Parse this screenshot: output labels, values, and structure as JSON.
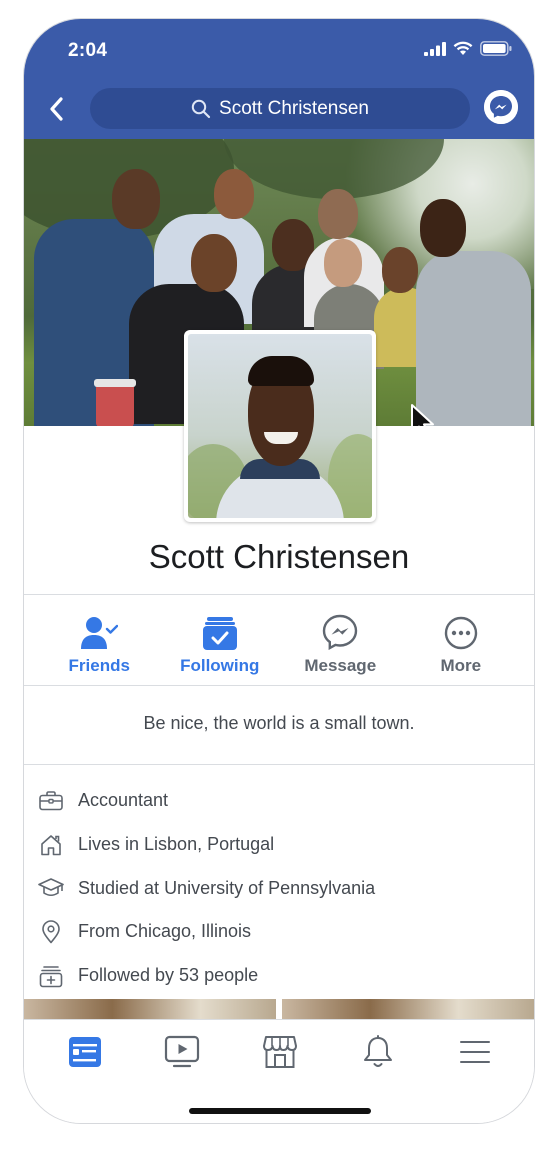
{
  "status_bar": {
    "time": "2:04"
  },
  "header": {
    "search_text": "Scott Christensen"
  },
  "profile": {
    "name": "Scott Christensen",
    "bio": "Be nice, the world is a small town."
  },
  "actions": [
    {
      "label": "Friends",
      "icon": "friends-check-icon"
    },
    {
      "label": "Following",
      "icon": "following-check-icon"
    },
    {
      "label": "Message",
      "icon": "messenger-icon"
    },
    {
      "label": "More",
      "icon": "more-dots-icon"
    }
  ],
  "about": [
    {
      "icon": "briefcase-icon",
      "text": "Accountant"
    },
    {
      "icon": "home-icon",
      "text": "Lives in Lisbon, Portugal"
    },
    {
      "icon": "graduation-cap-icon",
      "text": "Studied at University of Pennsylvania"
    },
    {
      "icon": "location-pin-icon",
      "text": "From Chicago, Illinois"
    },
    {
      "icon": "followers-icon",
      "text": "Followed by 53 people"
    }
  ],
  "bottom_tabs": [
    "news-feed-icon",
    "watch-icon",
    "marketplace-icon",
    "notifications-icon",
    "menu-icon"
  ],
  "colors": {
    "brand_blue": "#3b5ba9",
    "search_pill": "#2f4c93",
    "action_blue": "#3578e5",
    "text_grey": "#606770"
  }
}
